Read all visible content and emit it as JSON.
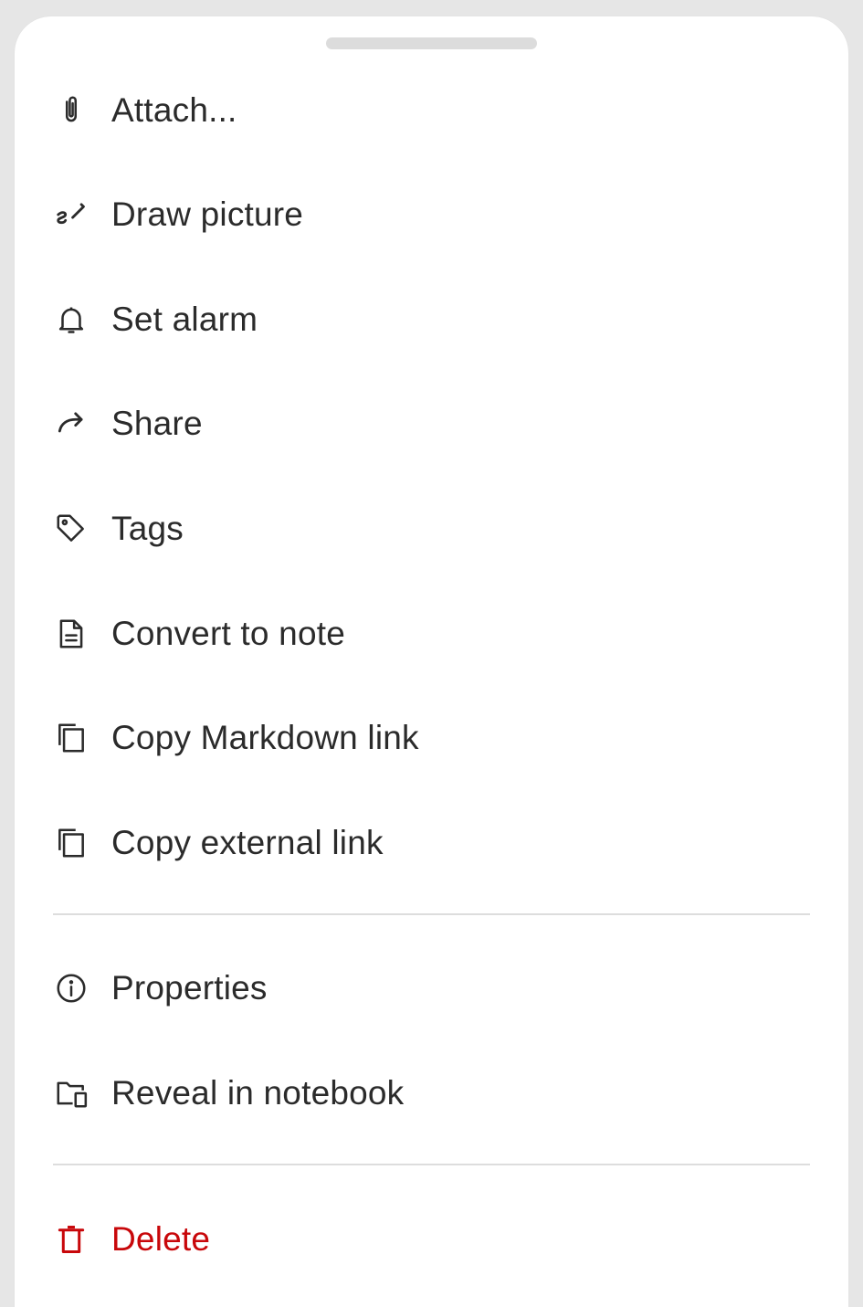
{
  "menu": {
    "items": [
      {
        "label": "Attach...",
        "icon": "paperclip-icon"
      },
      {
        "label": "Draw picture",
        "icon": "draw-icon"
      },
      {
        "label": "Set alarm",
        "icon": "bell-icon"
      },
      {
        "label": "Share",
        "icon": "share-icon"
      },
      {
        "label": "Tags",
        "icon": "tag-icon"
      },
      {
        "label": "Convert to note",
        "icon": "document-icon"
      },
      {
        "label": "Copy Markdown link",
        "icon": "copy-icon"
      },
      {
        "label": "Copy external link",
        "icon": "copy-icon"
      },
      {
        "label": "Properties",
        "icon": "info-icon"
      },
      {
        "label": "Reveal in notebook",
        "icon": "folder-reveal-icon"
      },
      {
        "label": "Delete",
        "icon": "trash-icon"
      }
    ]
  },
  "colors": {
    "background": "#e6e6e6",
    "sheet": "#ffffff",
    "text": "#2b2b2b",
    "danger": "#c8070a",
    "divider": "#dddddd",
    "handle": "#dcdcdc"
  }
}
